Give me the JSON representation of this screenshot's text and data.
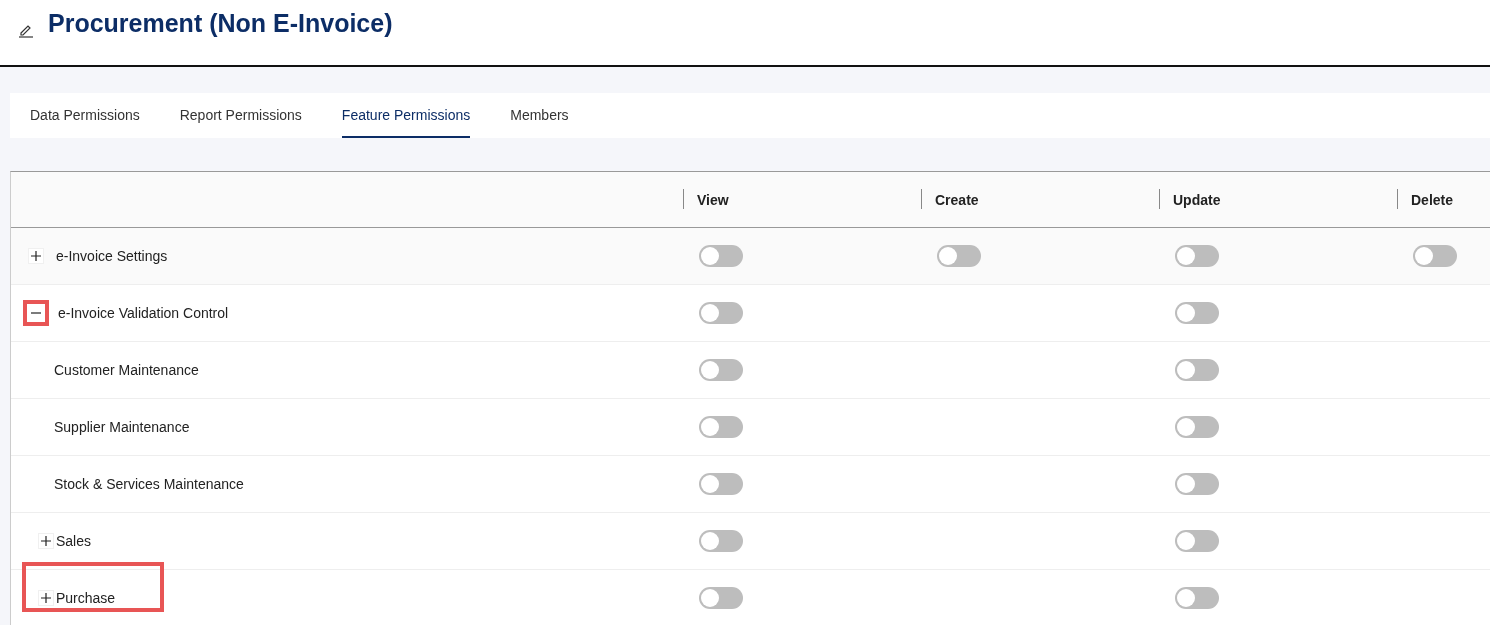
{
  "header": {
    "title": "Procurement (Non E-Invoice)"
  },
  "tabs": [
    {
      "label": "Data Permissions",
      "selected": false
    },
    {
      "label": "Report Permissions",
      "selected": false
    },
    {
      "label": "Feature Permissions",
      "selected": true
    },
    {
      "label": "Members",
      "selected": false
    }
  ],
  "table": {
    "columns": [
      "View",
      "Create",
      "Update",
      "Delete"
    ],
    "rows": [
      {
        "label": "e-Invoice Settings",
        "expanded": false,
        "hovered": true,
        "cells": [
          {
            "kind": "toggle",
            "on": false
          },
          {
            "kind": "toggle",
            "on": false
          },
          {
            "kind": "toggle",
            "on": false
          },
          {
            "kind": "toggle",
            "on": false
          }
        ]
      },
      {
        "label": "e-Invoice Validation Control",
        "expanded": true,
        "expander_highlighted": true,
        "cells": [
          {
            "kind": "toggle",
            "on": false
          },
          {
            "kind": "empty"
          },
          {
            "kind": "toggle",
            "on": false
          },
          {
            "kind": "empty"
          }
        ],
        "children": [
          {
            "label": "Customer Maintenance",
            "cells": [
              {
                "kind": "toggle",
                "on": false
              },
              {
                "kind": "empty"
              },
              {
                "kind": "toggle",
                "on": false
              },
              {
                "kind": "empty"
              }
            ]
          },
          {
            "label": "Supplier Maintenance",
            "cells": [
              {
                "kind": "toggle",
                "on": false
              },
              {
                "kind": "empty"
              },
              {
                "kind": "toggle",
                "on": false
              },
              {
                "kind": "empty"
              }
            ]
          },
          {
            "label": "Stock & Services Maintenance",
            "cells": [
              {
                "kind": "toggle",
                "on": false
              },
              {
                "kind": "empty"
              },
              {
                "kind": "toggle",
                "on": false
              },
              {
                "kind": "empty"
              }
            ]
          },
          {
            "label": "Sales",
            "expanded": false,
            "cells": [
              {
                "kind": "toggle",
                "on": false
              },
              {
                "kind": "empty"
              },
              {
                "kind": "toggle",
                "on": false
              },
              {
                "kind": "empty"
              }
            ]
          },
          {
            "label": "Purchase",
            "expanded": false,
            "label_highlighted": true,
            "cells": [
              {
                "kind": "toggle",
                "on": false
              },
              {
                "kind": "empty"
              },
              {
                "kind": "toggle",
                "on": false
              },
              {
                "kind": "empty"
              }
            ]
          }
        ]
      }
    ]
  }
}
